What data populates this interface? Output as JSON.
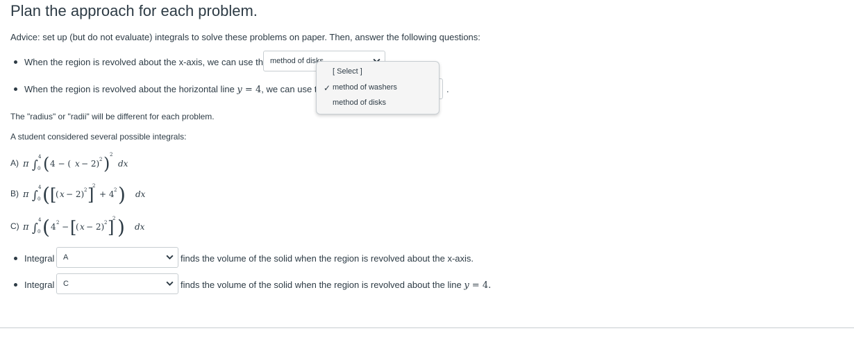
{
  "page": {
    "title": "Plan the approach for each problem.",
    "advice": "Advice: set up (but do not evaluate) integrals to solve these problems on paper. Then, answer the following questions:"
  },
  "q1": {
    "prefix": "When the region is revolved about the x-axis, we can use the",
    "selected": "method of disks"
  },
  "q2": {
    "prefix": "When the region is revolved about the horizontal line ",
    "line_var": "y",
    "line_eq": " = 4",
    "mid": ", we can use th",
    "suffix": "."
  },
  "dropdown": {
    "options": [
      "[ Select ]",
      "method of washers",
      "method of disks"
    ],
    "checked": "method of washers",
    "check_glyph": "✓"
  },
  "radius_note": "The \"radius\" or \"radii\" will be different for each problem.",
  "integrals_intro": "A student considered several possible integrals:",
  "integrals": [
    {
      "label": "A)"
    },
    {
      "label": "B)"
    },
    {
      "label": "C)"
    }
  ],
  "answers": [
    {
      "prefix": "Integral",
      "selected": "A",
      "suffix": "finds the volume of the solid when the region is revolved about the x-axis."
    },
    {
      "prefix": "Integral",
      "selected": "C",
      "suffix": "finds the volume of the solid when the region is revolved about the line ",
      "line_var": "y",
      "line_eq": " = 4."
    }
  ],
  "icons": {
    "select_chevron": "chevron-down-icon"
  }
}
